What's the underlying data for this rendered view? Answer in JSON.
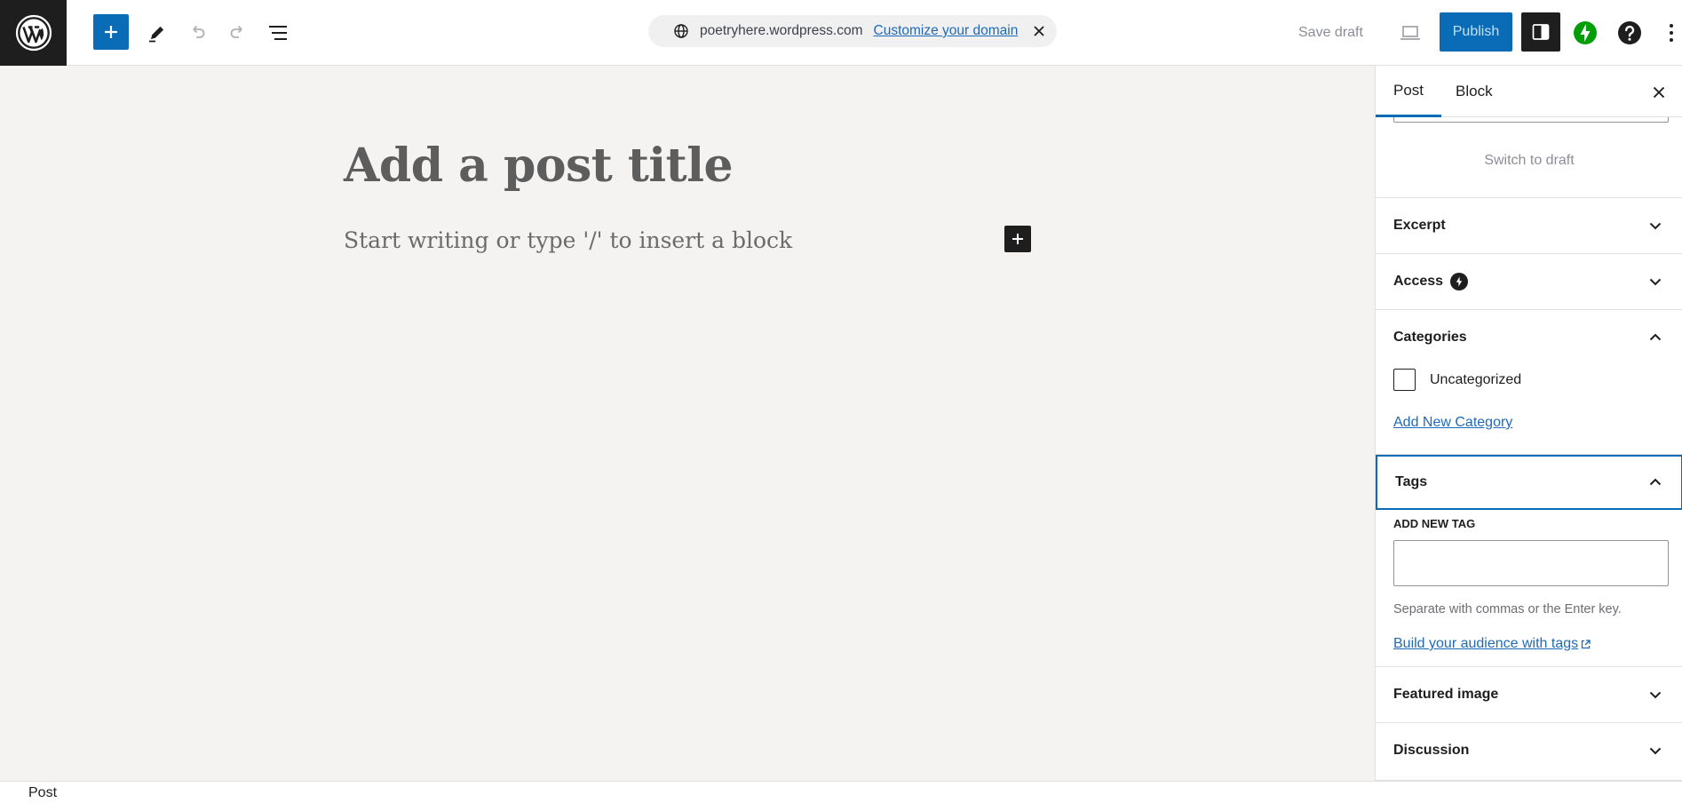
{
  "header": {
    "domain_host": "poetryhere.wordpress.com",
    "domain_link": "Customize your domain",
    "save_draft": "Save draft",
    "publish": "Publish"
  },
  "icons": {
    "logo": "wordpress-logo-icon",
    "add": "plus-icon",
    "tools": "pencil-icon",
    "undo": "undo-icon",
    "redo": "redo-icon",
    "outline": "document-overview-icon",
    "globe": "globe-icon",
    "close": "close-icon",
    "preview": "laptop-icon",
    "settings": "sidebar-icon",
    "jetpack": "jetpack-bolt-icon",
    "help": "help-icon",
    "more": "more-vertical-icon"
  },
  "editor": {
    "title_placeholder": "Add a post title",
    "body_placeholder": "Start writing or type '/' to insert a block"
  },
  "sidebar": {
    "tabs": [
      "Post",
      "Block"
    ],
    "switch_to_draft": "Switch to draft",
    "panels": {
      "excerpt": "Excerpt",
      "access": "Access",
      "categories": "Categories",
      "tags": "Tags",
      "featured_image": "Featured image",
      "discussion": "Discussion"
    },
    "categories": {
      "items": [
        "Uncategorized"
      ],
      "checked": [
        false
      ],
      "add_new": "Add New Category"
    },
    "tags": {
      "field_label": "ADD NEW TAG",
      "value": "",
      "help": "Separate with commas or the Enter key.",
      "link": "Build your audience with tags"
    }
  },
  "footer": {
    "breadcrumb": "Post"
  },
  "colors": {
    "accent": "#0a6cb6",
    "dark": "#1e1e1e",
    "jetpack_green": "#069e08",
    "canvas": "#f4f3f2"
  }
}
